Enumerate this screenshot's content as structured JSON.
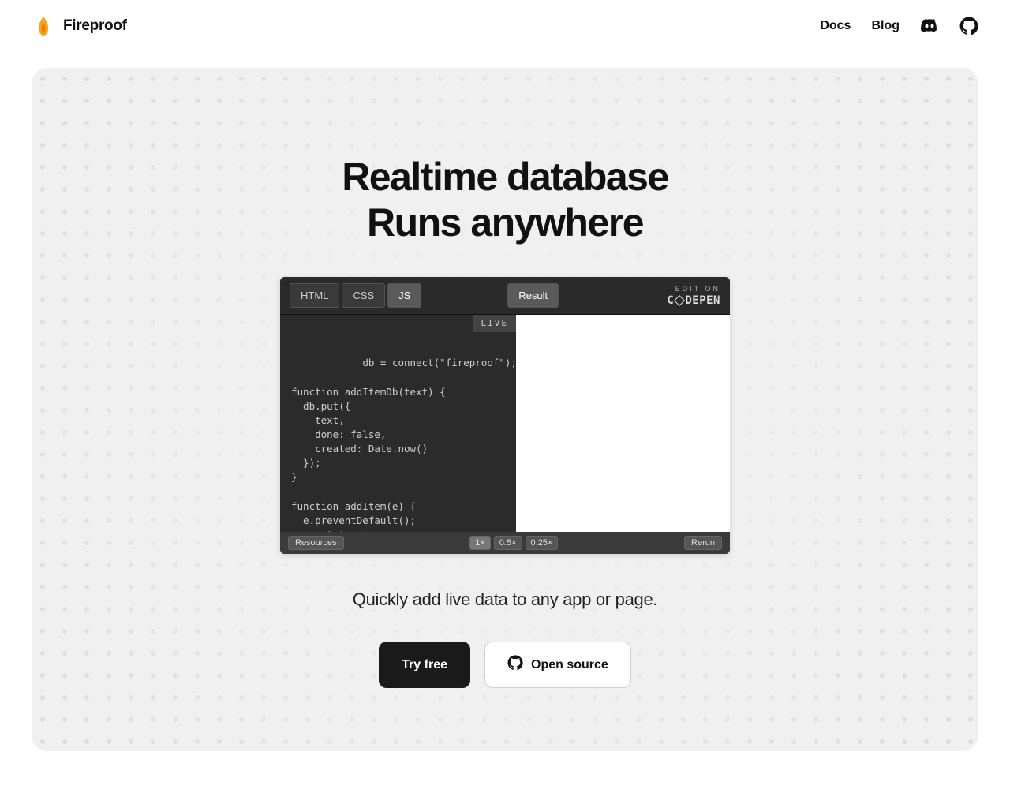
{
  "brand": {
    "name": "Fireproof"
  },
  "nav": {
    "docs": "Docs",
    "blog": "Blog"
  },
  "hero": {
    "line1": "Realtime database",
    "line2": "Runs anywhere",
    "tagline": "Quickly add live data to any app or page."
  },
  "cta": {
    "primary": "Try free",
    "secondary": "Open source"
  },
  "codepen": {
    "tab_html": "HTML",
    "tab_css": "CSS",
    "tab_js": "JS",
    "tab_result": "Result",
    "edit_on": "EDIT ON",
    "brand": "CODEPEN",
    "live": "LIVE",
    "code": "db = connect(\"fireproof\");\n\nfunction addItemDb(text) {\n  db.put({\n    text,\n    done: false,\n    created: Date.now()\n  });\n}\n\nfunction addItem(e) {\n  e.preventDefault();\n  const input =\ndocument.querySelector(\"form\ninput\");",
    "resources": "Resources",
    "zoom1": "1×",
    "zoom05": "0.5×",
    "zoom025": "0.25×",
    "rerun": "Rerun"
  }
}
